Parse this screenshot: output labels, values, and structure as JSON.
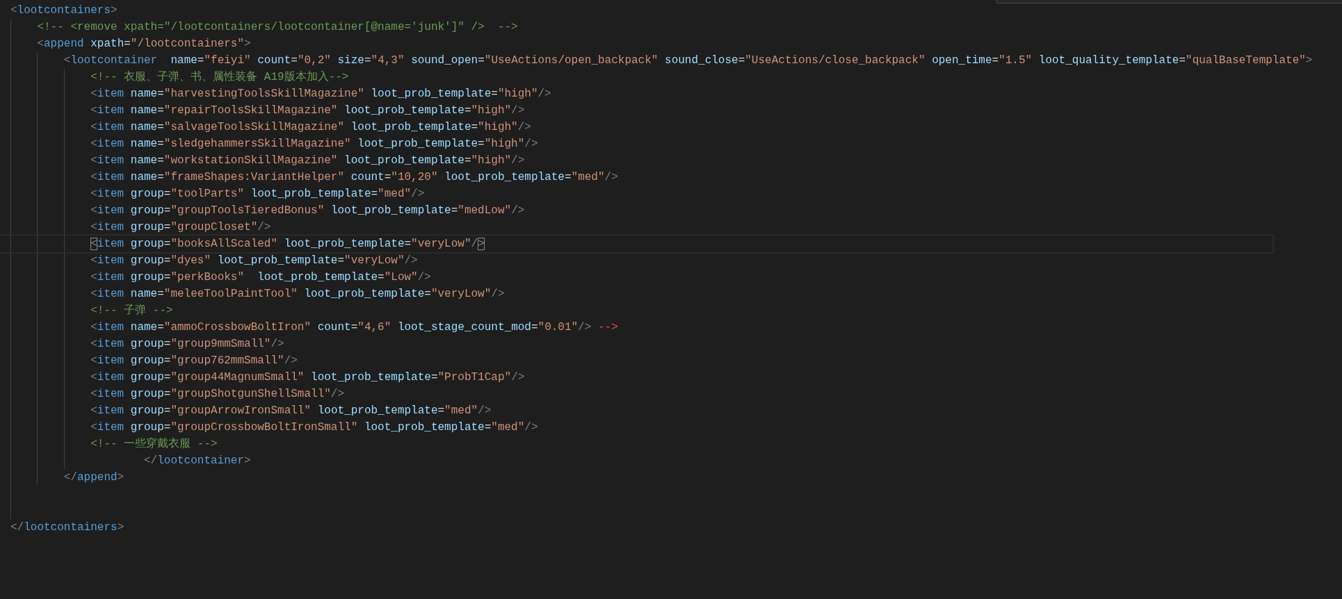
{
  "editor": {
    "lines": [
      {
        "kind": "code",
        "text": "<lootcontainers>",
        "current": false,
        "children": [
          {
            "kind": "comment",
            "text": "<!-- <remove xpath=\"/lootcontainers/lootcontainer[@name='junk']\" />  -->",
            "current": false
          },
          {
            "kind": "code",
            "text": "<append xpath=\"/lootcontainers\">",
            "current": false,
            "children": [
              {
                "kind": "code",
                "text": "<lootcontainer  name=\"feiyi\" count=\"0,2\" size=\"4,3\" sound_open=\"UseActions/open_backpack\" sound_close=\"UseActions/close_backpack\" open_time=\"1.5\" loot_quality_template=\"qualBaseTemplate\">",
                "current": false,
                "children": [
                  {
                    "kind": "comment",
                    "text": "<!-- 衣服、子弹、书、属性装备 A19版本加入-->",
                    "current": false
                  },
                  {
                    "kind": "code",
                    "text": "<item name=\"harvestingToolsSkillMagazine\" loot_prob_template=\"high\"/>",
                    "current": false
                  },
                  {
                    "kind": "code",
                    "text": "<item name=\"repairToolsSkillMagazine\" loot_prob_template=\"high\"/>",
                    "current": false
                  },
                  {
                    "kind": "code",
                    "text": "<item name=\"salvageToolsSkillMagazine\" loot_prob_template=\"high\"/>",
                    "current": false
                  },
                  {
                    "kind": "code",
                    "text": "<item name=\"sledgehammersSkillMagazine\" loot_prob_template=\"high\"/>",
                    "current": false
                  },
                  {
                    "kind": "code",
                    "text": "<item name=\"workstationSkillMagazine\" loot_prob_template=\"high\"/>",
                    "current": false
                  },
                  {
                    "kind": "code",
                    "text": "<item name=\"frameShapes:VariantHelper\" count=\"10,20\" loot_prob_template=\"med\"/>",
                    "current": false
                  },
                  {
                    "kind": "code",
                    "text": "<item group=\"toolParts\" loot_prob_template=\"med\"/>",
                    "current": false
                  },
                  {
                    "kind": "code",
                    "text": "<item group=\"groupToolsTieredBonus\" loot_prob_template=\"medLow\"/>",
                    "current": false
                  },
                  {
                    "kind": "code",
                    "text": "<item group=\"groupCloset\"/>",
                    "current": false
                  },
                  {
                    "kind": "code",
                    "text": "<item group=\"booksAllScaled\" loot_prob_template=\"veryLow\"/>",
                    "current": true
                  },
                  {
                    "kind": "code",
                    "text": "<item group=\"dyes\" loot_prob_template=\"veryLow\"/>",
                    "current": false
                  },
                  {
                    "kind": "code",
                    "text": "<item group=\"perkBooks\"  loot_prob_template=\"Low\"/>",
                    "current": false
                  },
                  {
                    "kind": "code",
                    "text": "<item name=\"meleeToolPaintTool\" loot_prob_template=\"veryLow\"/>",
                    "current": false
                  },
                  {
                    "kind": "comment",
                    "text": "<!-- 子弹 -->",
                    "current": false
                  },
                  {
                    "kind": "code",
                    "text": "<item name=\"ammoCrossbowBoltIron\" count=\"4,6\" loot_stage_count_mod=\"0.01\"/> -->",
                    "current": false
                  },
                  {
                    "kind": "code",
                    "text": "<item group=\"group9mmSmall\"/>",
                    "current": false
                  },
                  {
                    "kind": "code",
                    "text": "<item group=\"group762mmSmall\"/>",
                    "current": false
                  },
                  {
                    "kind": "code",
                    "text": "<item group=\"group44MagnumSmall\" loot_prob_template=\"ProbT1Cap\"/>",
                    "current": false
                  },
                  {
                    "kind": "code",
                    "text": "<item group=\"groupShotgunShellSmall\"/>",
                    "current": false
                  },
                  {
                    "kind": "code",
                    "text": "<item group=\"groupArrowIronSmall\" loot_prob_template=\"med\"/>",
                    "current": false
                  },
                  {
                    "kind": "code",
                    "text": "<item group=\"groupCrossbowBoltIronSmall\" loot_prob_template=\"med\"/>",
                    "current": false
                  },
                  {
                    "kind": "comment",
                    "text": "<!-- 一些穿戴衣服 -->",
                    "current": false
                  },
                  {
                    "kind": "code",
                    "text": "        </lootcontainer>",
                    "current": false
                  }
                ]
              },
              {
                "kind": "code",
                "text": "</append>",
                "current": false
              }
            ]
          }
        ]
      },
      {
        "kind": "code",
        "text": "</lootcontainers>",
        "current": false
      }
    ]
  }
}
